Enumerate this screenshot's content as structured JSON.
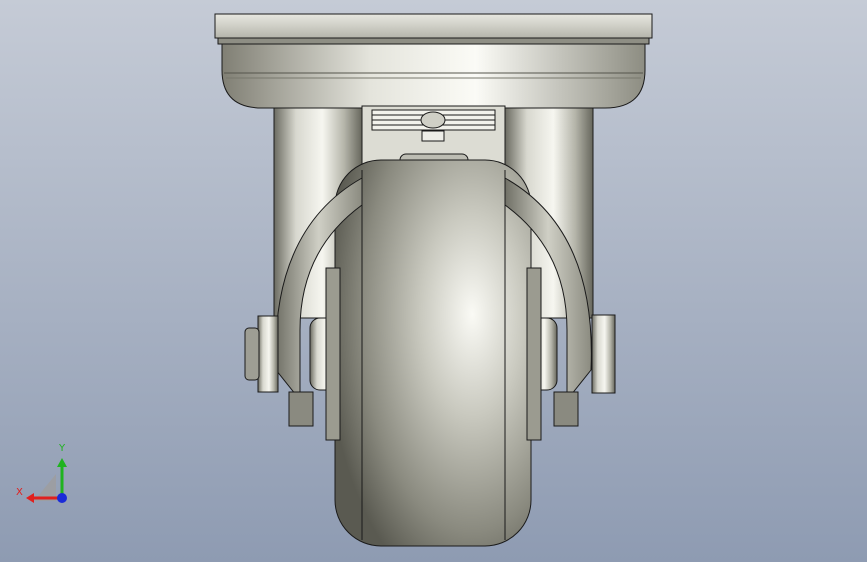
{
  "viewport": {
    "background_top": "#c5cbd6",
    "background_bottom": "#8e9bb2"
  },
  "triad": {
    "x_label": "X",
    "y_label": "Y",
    "x_color": "#e0201e",
    "y_color": "#1fb31f",
    "z_color": "#1a2bd8"
  },
  "model": {
    "metal_light": "#f4f4ee",
    "metal_mid": "#b9b9ad",
    "metal_dark": "#5e5e54",
    "edge_color": "#1a1a1a"
  }
}
